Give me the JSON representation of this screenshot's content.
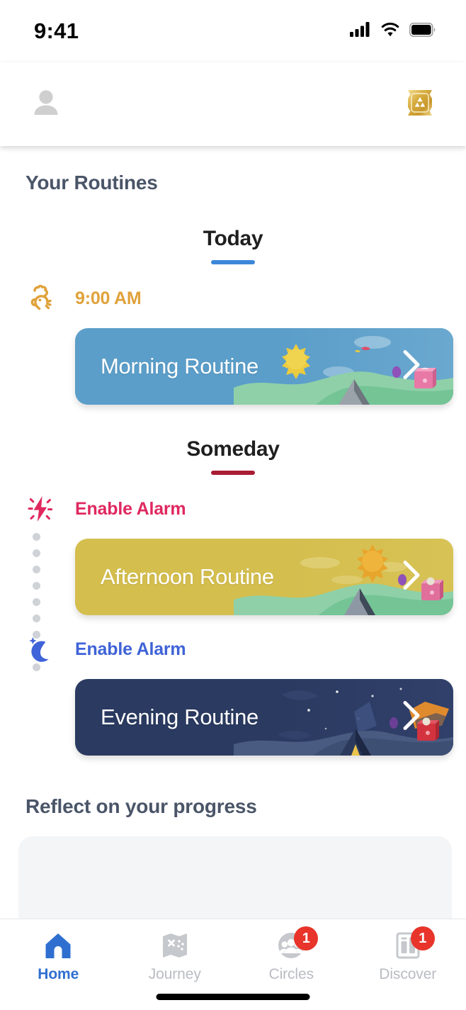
{
  "status_bar": {
    "time": "9:41",
    "icons": [
      "cellular-signal-icon",
      "wifi-icon",
      "battery-icon"
    ]
  },
  "header": {
    "avatar_icon": "person-avatar-icon",
    "badge_icon": "gold-achievement-badge-icon",
    "badge_color": "#d9a93a"
  },
  "main": {
    "routines_title": "Your Routines",
    "reflect_title": "Reflect on your progress",
    "groups": [
      {
        "day_label": "Today",
        "underline_color": "#3c87d8",
        "items": [
          {
            "alarm_label": "9:00 AM",
            "alarm_color": "#e0a23a",
            "alarm_icon": "rooster-icon",
            "card_title": "Morning Routine",
            "card_color": "#5b9ec9",
            "art": "morning-landscape-art",
            "chevron_icon": "chevron-right-icon",
            "connector": false
          }
        ]
      },
      {
        "day_label": "Someday",
        "underline_color": "#a81c34",
        "items": [
          {
            "alarm_label": "Enable Alarm",
            "alarm_color": "#e0285f",
            "alarm_icon": "lightning-bolt-icon",
            "card_title": "Afternoon Routine",
            "card_color": "#d4be4e",
            "art": "afternoon-landscape-art",
            "chevron_icon": "chevron-right-icon",
            "connector": true
          },
          {
            "alarm_label": "Enable Alarm",
            "alarm_color": "#3f63d8",
            "alarm_icon": "crescent-moon-icon",
            "card_title": "Evening Routine",
            "card_color": "#2a3a60",
            "art": "evening-night-landscape-art",
            "chevron_icon": "chevron-right-icon",
            "connector": false
          }
        ]
      }
    ]
  },
  "tabbar": {
    "items": [
      {
        "label": "Home",
        "icon": "home-icon",
        "active": true,
        "badge": ""
      },
      {
        "label": "Journey",
        "icon": "map-icon",
        "active": false,
        "badge": ""
      },
      {
        "label": "Circles",
        "icon": "people-icon",
        "active": false,
        "badge": "1"
      },
      {
        "label": "Discover",
        "icon": "document-icon",
        "active": false,
        "badge": "1"
      }
    ],
    "active_color": "#2f6fd0",
    "idle_color": "#c5c8cc",
    "badge_color": "#e8342a"
  }
}
